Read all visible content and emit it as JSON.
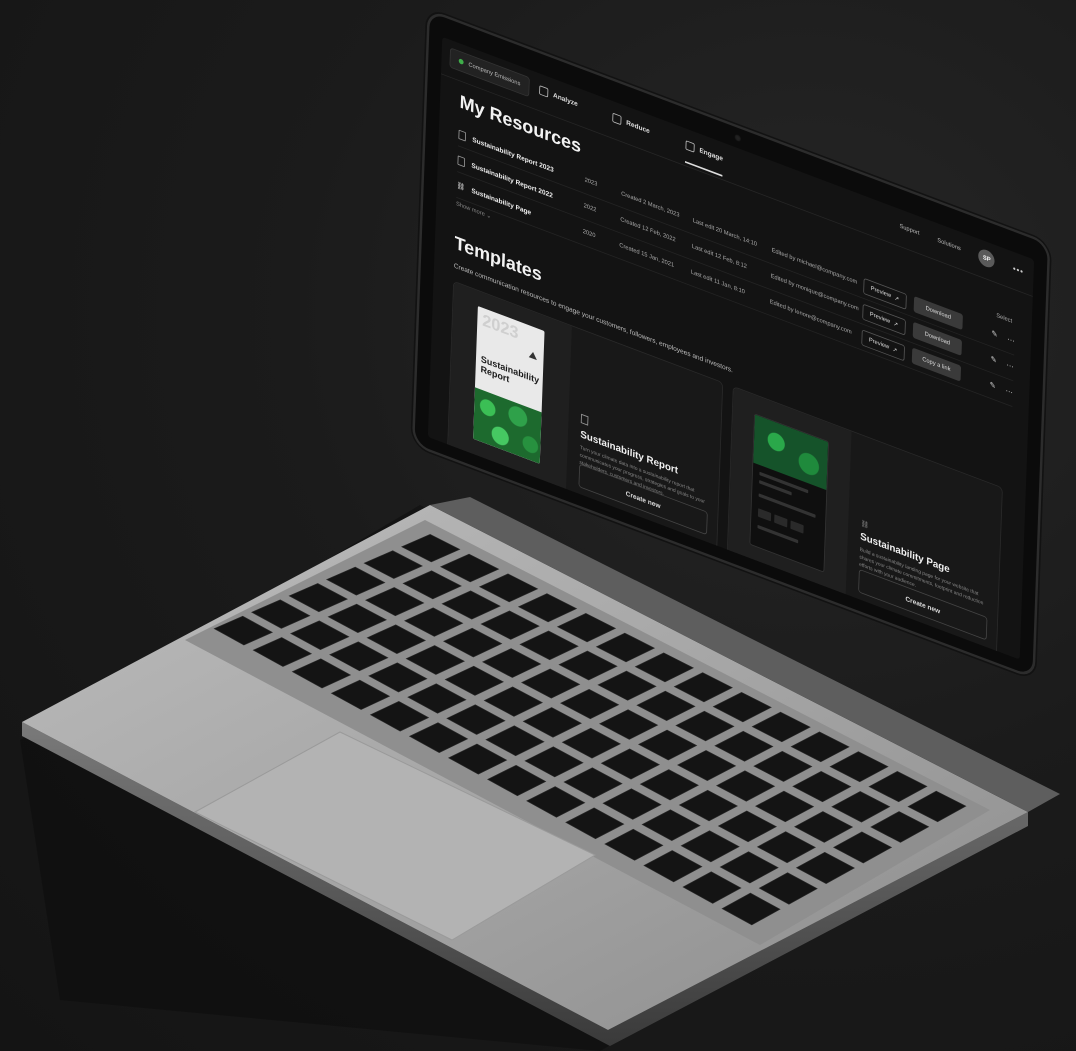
{
  "nav": {
    "company": "Company Emissions",
    "tabs": [
      {
        "label": "Analyze",
        "icon": "document-icon"
      },
      {
        "label": "Reduce",
        "icon": "cart-icon"
      },
      {
        "label": "Engage",
        "icon": "badge-icon",
        "active": true
      }
    ],
    "support": "Support",
    "solutions": "Solutions",
    "avatar_initials": "SP",
    "more": "•••"
  },
  "resources": {
    "title": "My Resources",
    "select_label": "Select",
    "rows": [
      {
        "name": "Sustainability Report 2023",
        "year": "2023",
        "created": "Created 2 March, 2023",
        "edited": "Last edit 20 March, 14:10",
        "by": "Edited by michael@company.com",
        "preview": "Preview",
        "action": "Download",
        "icon": "document-icon"
      },
      {
        "name": "Sustainability Report 2022",
        "year": "2022",
        "created": "Created 12 Feb, 2022",
        "edited": "Last edit 12 Feb, 8:12",
        "by": "Edited by monique@company.com",
        "preview": "Preview",
        "action": "Download",
        "icon": "document-icon"
      },
      {
        "name": "Sustainability Page",
        "year": "2020",
        "created": "Created 15 Jan, 2021",
        "edited": "Last edit 11 Jan, 8:10",
        "by": "Edited by lenore@company.com",
        "preview": "Preview",
        "action": "Copy a link",
        "icon": "link-icon"
      }
    ],
    "show_more": "Show more ⌄"
  },
  "templates": {
    "title": "Templates",
    "subtitle": "Create communication resources to engage your customers, followers, employees and investors.",
    "cards": [
      {
        "name": "Sustainability Report",
        "cover_number": "2023",
        "cover_title": "Sustainability Report",
        "description": "Turn your climate data into a sustainability report that communicates your progress, strategies and goals to your stakeholders, customers and investors.",
        "button": "Create new"
      },
      {
        "name": "Sustainability Page",
        "description": "Build a sustainability landing page for your website that shares your climate commitments, footprint and reduction efforts with your audience.",
        "button": "Create new"
      }
    ]
  },
  "colors": {
    "accent_green": "#3fae4a",
    "screen_bg": "#131313",
    "aluminium": "#a9a9a9"
  }
}
